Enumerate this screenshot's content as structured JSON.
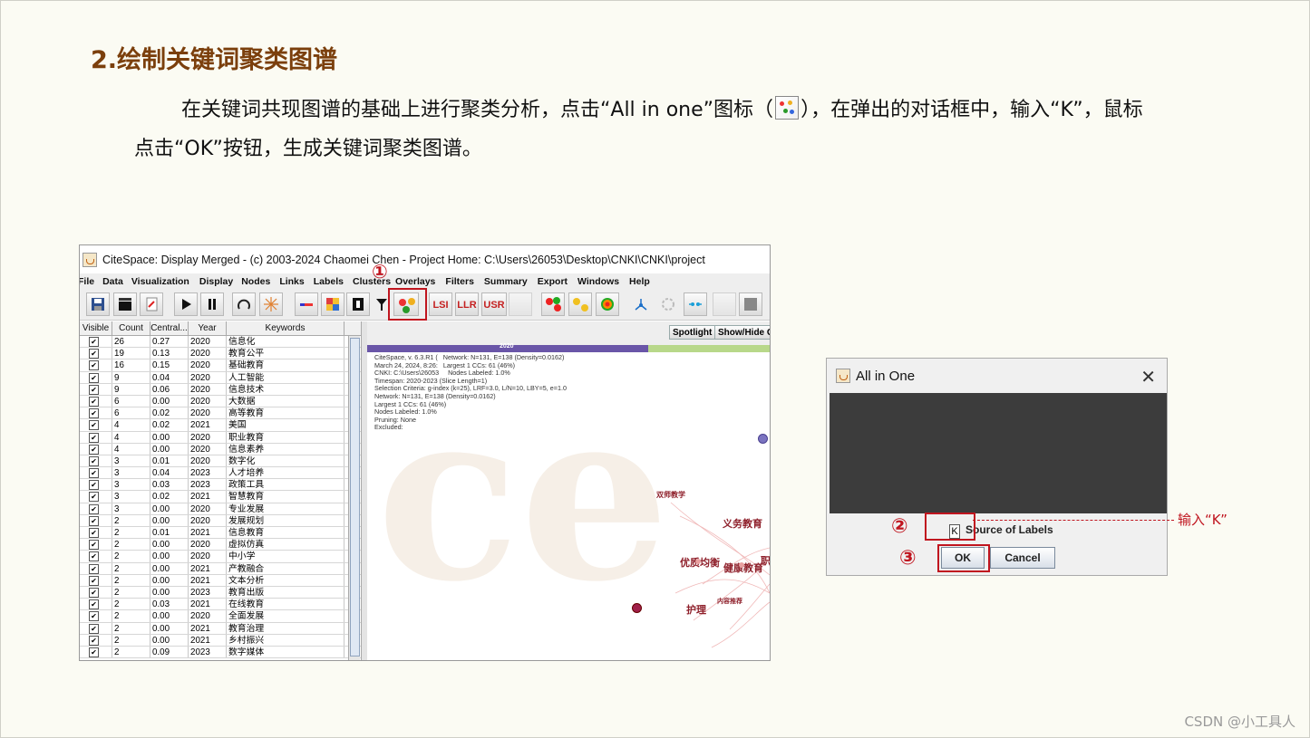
{
  "heading": "2.绘制关键词聚类图谱",
  "paragraph": {
    "line1_a": "在关键词共现图谱的基础上进行聚类分析，点击“All in one”图标（",
    "line1_b": "），在弹出的对话框中，输入“K”，鼠标",
    "line2": "点击“OK”按钮，生成关键词聚类图谱。"
  },
  "watermark": "CSDN @小工具人",
  "citespace": {
    "title": "CiteSpace: Display Merged - (c) 2003-2024 Chaomei Chen - Project Home: C:\\Users\\26053\\Desktop\\CNKI\\CNKI\\project",
    "menu": [
      "File",
      "Data",
      "Visualization",
      "Display",
      "Nodes",
      "Links",
      "Labels",
      "Clusters",
      "Overlays",
      "Filters",
      "Summary",
      "Export",
      "Windows",
      "Help"
    ],
    "toolbar": {
      "lsi": "LSI",
      "llr": "LLR",
      "usr": "USR"
    },
    "table": {
      "headers": [
        "Visible",
        "Count",
        "Central...",
        "Year",
        "Keywords"
      ],
      "rows": [
        [
          "26",
          "0.27",
          "2020",
          "信息化"
        ],
        [
          "19",
          "0.13",
          "2020",
          "教育公平"
        ],
        [
          "16",
          "0.15",
          "2020",
          "基础教育"
        ],
        [
          "9",
          "0.04",
          "2020",
          "人工智能"
        ],
        [
          "9",
          "0.06",
          "2020",
          "信息技术"
        ],
        [
          "6",
          "0.00",
          "2020",
          "大数据"
        ],
        [
          "6",
          "0.02",
          "2020",
          "高等教育"
        ],
        [
          "4",
          "0.02",
          "2021",
          "美国"
        ],
        [
          "4",
          "0.00",
          "2020",
          "职业教育"
        ],
        [
          "4",
          "0.00",
          "2020",
          "信息素养"
        ],
        [
          "3",
          "0.01",
          "2020",
          "数字化"
        ],
        [
          "3",
          "0.04",
          "2023",
          "人才培养"
        ],
        [
          "3",
          "0.03",
          "2023",
          "政策工具"
        ],
        [
          "3",
          "0.02",
          "2021",
          "智慧教育"
        ],
        [
          "3",
          "0.00",
          "2020",
          "专业发展"
        ],
        [
          "2",
          "0.00",
          "2020",
          "发展规划"
        ],
        [
          "2",
          "0.01",
          "2021",
          "信息教育"
        ],
        [
          "2",
          "0.00",
          "2020",
          "虚拟仿真"
        ],
        [
          "2",
          "0.00",
          "2020",
          "中小学"
        ],
        [
          "2",
          "0.00",
          "2021",
          "产教融合"
        ],
        [
          "2",
          "0.00",
          "2021",
          "文本分析"
        ],
        [
          "2",
          "0.00",
          "2023",
          "教育出版"
        ],
        [
          "2",
          "0.03",
          "2021",
          "在线教育"
        ],
        [
          "2",
          "0.00",
          "2020",
          "全面发展"
        ],
        [
          "2",
          "0.00",
          "2021",
          "教育治理"
        ],
        [
          "2",
          "0.00",
          "2021",
          "乡村振兴"
        ],
        [
          "2",
          "0.09",
          "2023",
          "数字媒体"
        ]
      ]
    },
    "canvas": {
      "spotlight": "Spotlight",
      "show_hide": "Show/Hide C",
      "year_label": "2020",
      "info_lines": [
        "CiteSpace, v. 6.3.R1 (   Network: N=131, E=138 (Density=0.0162)",
        "March 24, 2024, 8:26:   Largest 1 CCs: 61 (46%)",
        "CNKI: C:\\Users\\26053     Nodes Labeled: 1.0%",
        "Timespan: 2020-2023 (Slice Length=1)",
        "Selection Criteria: g-index (k=25), LRF=3.0, L/N=10, LBY=5, e=1.0",
        "Network: N=131, E=138 (Density=0.0162)",
        "Largest 1 CCs: 61 (46%)",
        "Nodes Labeled: 1.0%",
        "Pruning: None",
        "Excluded:"
      ],
      "cluster_labels": [
        "双师教学",
        "义务教育",
        "优质均衡",
        "健康教育",
        "护理",
        "内容推荐",
        "职"
      ]
    }
  },
  "dialog": {
    "title": "All in One",
    "field_value": "K",
    "label": "Source of Labels",
    "ok": "OK",
    "cancel": "Cancel"
  },
  "annotations": {
    "step1": "①",
    "step2": "②",
    "step3": "③",
    "note": "输入“K”"
  }
}
